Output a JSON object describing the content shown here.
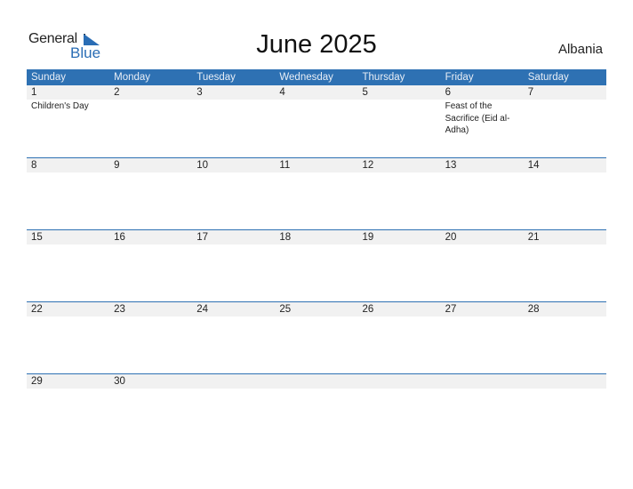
{
  "brand": {
    "line1": "General",
    "line2": "Blue",
    "accent": "#2a6db5"
  },
  "title": "June 2025",
  "country": "Albania",
  "header_color": "#2e71b3",
  "weekdays": [
    "Sunday",
    "Monday",
    "Tuesday",
    "Wednesday",
    "Thursday",
    "Friday",
    "Saturday"
  ],
  "weeks": [
    [
      {
        "day": "1",
        "event": "Children's Day"
      },
      {
        "day": "2",
        "event": ""
      },
      {
        "day": "3",
        "event": ""
      },
      {
        "day": "4",
        "event": ""
      },
      {
        "day": "5",
        "event": ""
      },
      {
        "day": "6",
        "event": "Feast of the Sacrifice (Eid al-Adha)"
      },
      {
        "day": "7",
        "event": ""
      }
    ],
    [
      {
        "day": "8",
        "event": ""
      },
      {
        "day": "9",
        "event": ""
      },
      {
        "day": "10",
        "event": ""
      },
      {
        "day": "11",
        "event": ""
      },
      {
        "day": "12",
        "event": ""
      },
      {
        "day": "13",
        "event": ""
      },
      {
        "day": "14",
        "event": ""
      }
    ],
    [
      {
        "day": "15",
        "event": ""
      },
      {
        "day": "16",
        "event": ""
      },
      {
        "day": "17",
        "event": ""
      },
      {
        "day": "18",
        "event": ""
      },
      {
        "day": "19",
        "event": ""
      },
      {
        "day": "20",
        "event": ""
      },
      {
        "day": "21",
        "event": ""
      }
    ],
    [
      {
        "day": "22",
        "event": ""
      },
      {
        "day": "23",
        "event": ""
      },
      {
        "day": "24",
        "event": ""
      },
      {
        "day": "25",
        "event": ""
      },
      {
        "day": "26",
        "event": ""
      },
      {
        "day": "27",
        "event": ""
      },
      {
        "day": "28",
        "event": ""
      }
    ],
    [
      {
        "day": "29",
        "event": ""
      },
      {
        "day": "30",
        "event": ""
      },
      {
        "day": "",
        "event": ""
      },
      {
        "day": "",
        "event": ""
      },
      {
        "day": "",
        "event": ""
      },
      {
        "day": "",
        "event": ""
      },
      {
        "day": "",
        "event": ""
      }
    ]
  ]
}
